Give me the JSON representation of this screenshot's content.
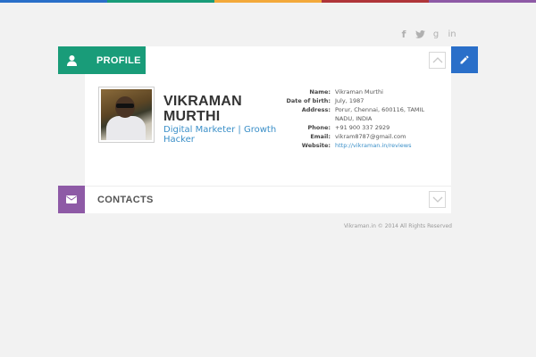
{
  "colors": {
    "topbar": [
      "#2a6fc9",
      "#199c79",
      "#f3a93b",
      "#b0353a",
      "#8e5aa6"
    ],
    "profile_accent": "#199c79",
    "contacts_accent": "#8e5aa6",
    "edit_accent": "#2a6fc9",
    "link": "#3a8fc8"
  },
  "social": {
    "facebook": "f",
    "twitter": "t",
    "googleplus": "g",
    "linkedin": "in"
  },
  "profile": {
    "tab_label": "PROFILE",
    "name": "VIKRAMAN MURTHI",
    "role": "Digital Marketer | Growth Hacker",
    "details": [
      {
        "key": "Name:",
        "value": "Vikraman Murthi"
      },
      {
        "key": "Date of birth:",
        "value": "July, 1987"
      },
      {
        "key": "Address:",
        "value": "Porur, Chennai, 600116, TAMIL NADU, INDIA"
      },
      {
        "key": "Phone:",
        "value": "+91 900 337 2929"
      },
      {
        "key": "Email:",
        "value": "vikram8787@gmail.com"
      },
      {
        "key": "Website:",
        "value": "http://vikraman.in/reviews"
      }
    ]
  },
  "contacts": {
    "tab_label": "CONTACTS"
  },
  "footer": "Vikraman.in © 2014 All Rights Reserved"
}
